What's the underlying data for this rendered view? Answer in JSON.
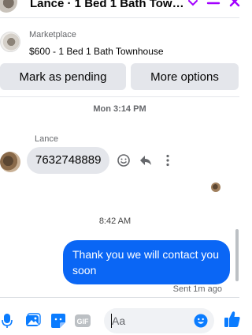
{
  "header": {
    "title": "Lance · 1 Bed 1 Bath Townhouse",
    "accent_color": "#a200ff"
  },
  "listing": {
    "source": "Marketplace",
    "title": "$600 - 1 Bed 1 Bath Townhouse"
  },
  "actions": {
    "mark_pending_label": "Mark as pending",
    "more_options_label": "More options"
  },
  "conversation": {
    "timestamp_1": "Mon 3:14 PM",
    "sender_name": "Lance",
    "incoming_message": "7632748889",
    "timestamp_2": "8:42 AM",
    "outgoing_message": "Thank you we will contact you soon",
    "sent_status": "Sent 1m ago"
  },
  "composer": {
    "placeholder": "Aa",
    "icons": [
      "mic-icon",
      "photo-icon",
      "sticker-icon",
      "gif-icon",
      "emoji-icon",
      "like-icon"
    ],
    "gif_label": "GIF",
    "accent_color": "#0a7cff"
  },
  "colors": {
    "outgoing_bubble": "#0a66f5",
    "incoming_bubble": "#e4e6eb",
    "button_bg": "#e4e6eb"
  }
}
